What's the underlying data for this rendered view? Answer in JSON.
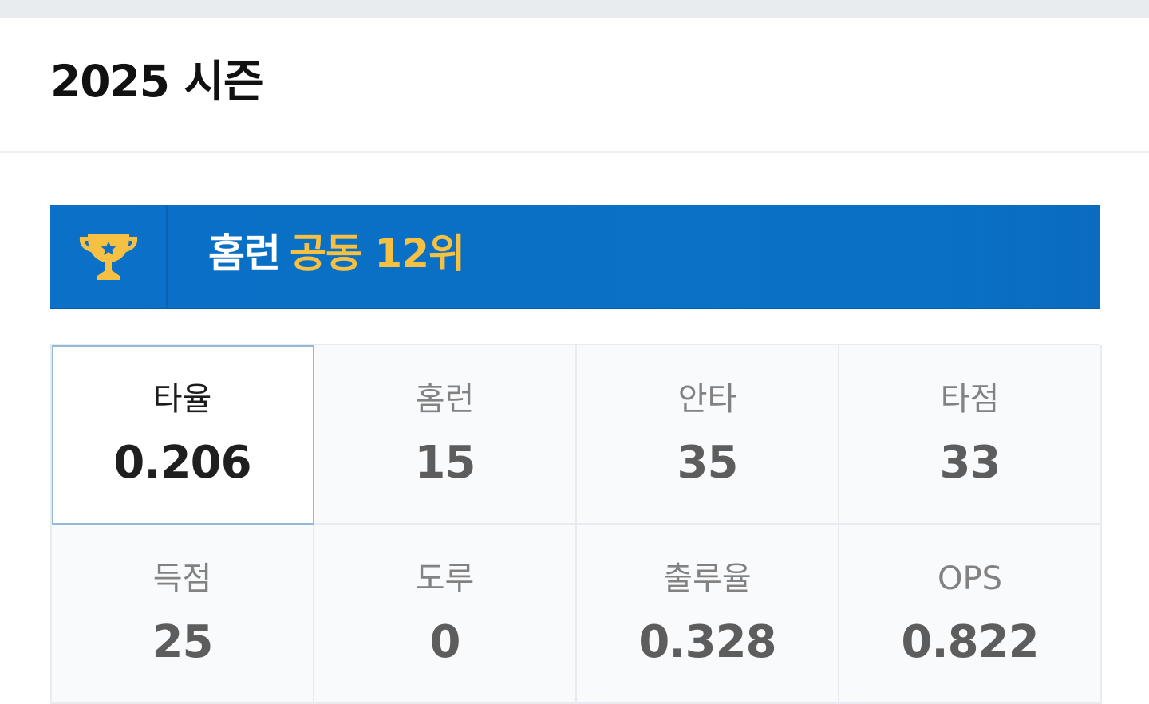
{
  "header": {
    "title": "2025 시즌"
  },
  "rank_banner": {
    "icon": "trophy-icon",
    "category": "홈런",
    "rank": "공동 12위",
    "accent_color": "#f6c143",
    "background_color": "#0871c5"
  },
  "stats": [
    {
      "label": "타율",
      "value": "0.206",
      "selected": true
    },
    {
      "label": "홈런",
      "value": "15",
      "selected": false
    },
    {
      "label": "안타",
      "value": "35",
      "selected": false
    },
    {
      "label": "타점",
      "value": "33",
      "selected": false
    },
    {
      "label": "득점",
      "value": "25",
      "selected": false
    },
    {
      "label": "도루",
      "value": "0",
      "selected": false
    },
    {
      "label": "출루율",
      "value": "0.328",
      "selected": false
    },
    {
      "label": "OPS",
      "value": "0.822",
      "selected": false
    }
  ]
}
